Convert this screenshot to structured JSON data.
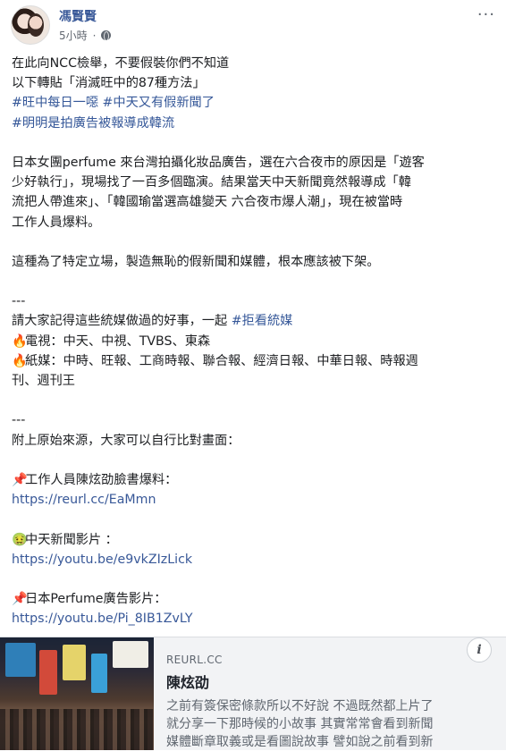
{
  "header": {
    "author": "馮賢賢",
    "time": "5小時",
    "more": "···"
  },
  "post": {
    "lines": [
      {
        "type": "text",
        "text": "在此向NCC檢舉，不要假裝你們不知道"
      },
      {
        "type": "text",
        "text": "以下轉貼「消滅旺中的87種方法」"
      },
      {
        "type": "hashtags",
        "items": [
          "#旺中每日一噁",
          "#中天又有假新聞了"
        ]
      },
      {
        "type": "hashtags",
        "items": [
          "#明明是拍廣告被報導成韓流"
        ]
      },
      {
        "type": "blank"
      },
      {
        "type": "text",
        "text": "日本女團perfume 來台灣拍攝化妝品廣告，選在六合夜市的原因是「遊客"
      },
      {
        "type": "text",
        "text": "少好執行」，現場找了一百多個臨演。結果當天中天新聞竟然報導成「韓"
      },
      {
        "type": "text",
        "text": "流把人帶進來」、「韓國瑜當選高雄變天 六合夜市爆人潮」，現在被當時"
      },
      {
        "type": "text",
        "text": "工作人員爆料。"
      },
      {
        "type": "blank"
      },
      {
        "type": "text",
        "text": "這種為了特定立場，製造無恥的假新聞和媒體，根本應該被下架。"
      },
      {
        "type": "blank"
      },
      {
        "type": "text",
        "text": "---"
      },
      {
        "type": "text_tag",
        "text": "請大家記得這些統媒做過的好事，一起 ",
        "tag": "#拒看統媒"
      },
      {
        "type": "emoji",
        "emoji": "fire",
        "text": "電視：中天、中視、TVBS、東森"
      },
      {
        "type": "emoji",
        "emoji": "fire",
        "text": "紙媒：中時、旺報、工商時報、聯合報、經濟日報、中華日報、時報週"
      },
      {
        "type": "text",
        "text": "刊、週刊王"
      },
      {
        "type": "blank"
      },
      {
        "type": "text",
        "text": "---"
      },
      {
        "type": "text",
        "text": "附上原始來源，大家可以自行比對畫面："
      },
      {
        "type": "blank"
      },
      {
        "type": "emoji",
        "emoji": "pin",
        "text": "工作人員陳炫劭臉書爆料："
      },
      {
        "type": "link",
        "text": "https://reurl.cc/EaMmn"
      },
      {
        "type": "blank"
      },
      {
        "type": "emoji",
        "emoji": "sick",
        "text": "中天新聞影片 ："
      },
      {
        "type": "link",
        "text": "https://youtu.be/e9vkZIzLick"
      },
      {
        "type": "blank"
      },
      {
        "type": "emoji",
        "emoji": "pin",
        "text": "日本Perfume廣告影片："
      },
      {
        "type": "link",
        "text": "https://youtu.be/Pi_8IB1ZvLY"
      }
    ]
  },
  "icons": {
    "fire": "🔥",
    "pin": "📌",
    "sick": "🤢"
  },
  "preview": {
    "domain": "REURL.CC",
    "title": "陳炫劭",
    "description_lines": [
      "之前有簽保密條款所以不好說 不過既然都上片了",
      "就分享一下那時候的小故事 其實常常會看到新聞",
      "媒體斷章取義或是看圖說故事 譬如說之前看到新"
    ],
    "info": "i"
  }
}
